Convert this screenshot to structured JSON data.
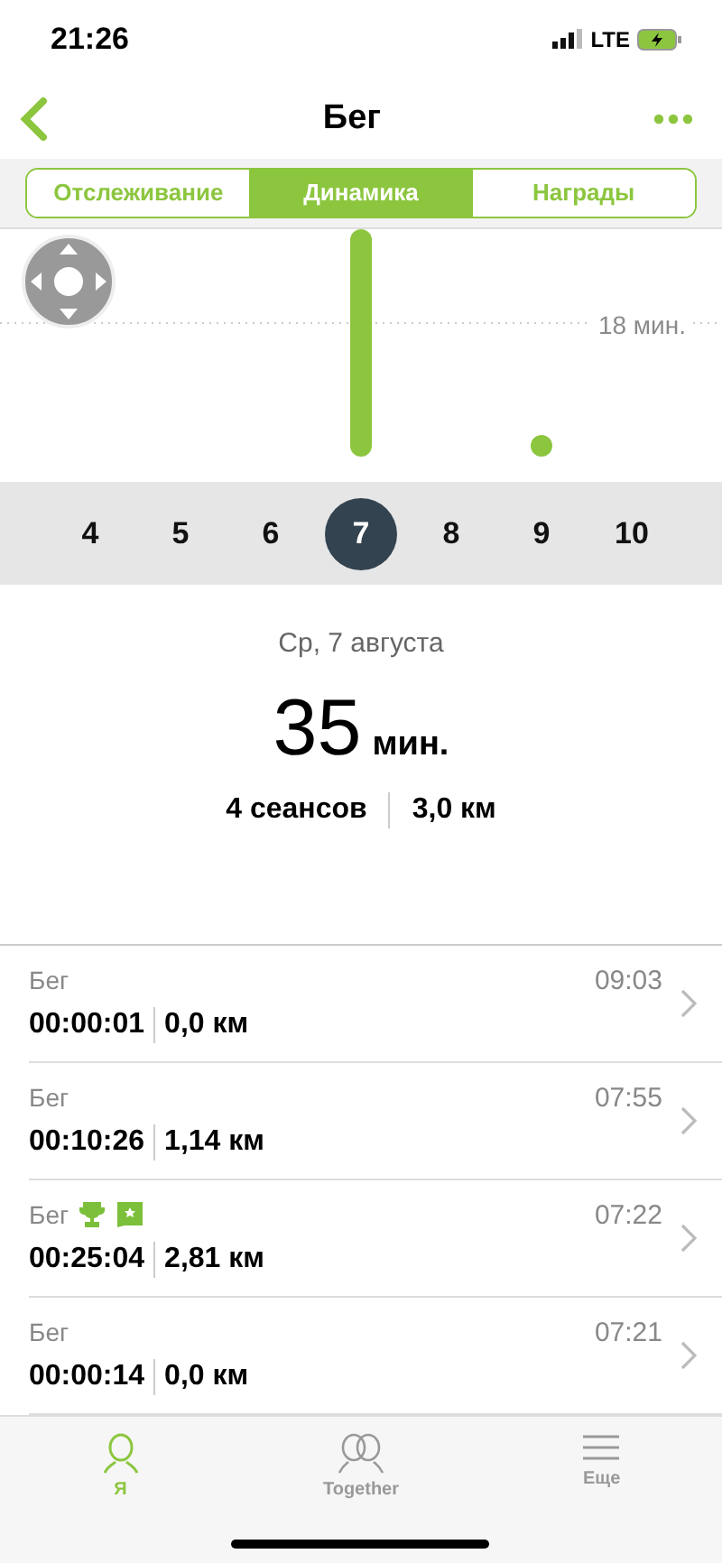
{
  "status_bar": {
    "time": "21:26",
    "network": "LTE"
  },
  "nav": {
    "title": "Бег"
  },
  "tabs": [
    {
      "label": "Отслеживание",
      "selected": false
    },
    {
      "label": "Динамика",
      "selected": true
    },
    {
      "label": "Награды",
      "selected": false
    }
  ],
  "chart": {
    "reference_label": "18 мин."
  },
  "days": [
    {
      "label": "4",
      "selected": false
    },
    {
      "label": "5",
      "selected": false
    },
    {
      "label": "6",
      "selected": false
    },
    {
      "label": "7",
      "selected": true
    },
    {
      "label": "8",
      "selected": false
    },
    {
      "label": "9",
      "selected": false
    },
    {
      "label": "10",
      "selected": false
    }
  ],
  "summary": {
    "date": "Ср, 7 августа",
    "value": "35",
    "unit": "мин.",
    "sessions": "4 сеансов",
    "distance": "3,0 км"
  },
  "workouts": [
    {
      "name": "Бег",
      "time": "09:03",
      "duration": "00:00:01",
      "distance": "0,0 км",
      "badges": false
    },
    {
      "name": "Бег",
      "time": "07:55",
      "duration": "00:10:26",
      "distance": "1,14 км",
      "badges": false
    },
    {
      "name": "Бег",
      "time": "07:22",
      "duration": "00:25:04",
      "distance": "2,81 км",
      "badges": true
    },
    {
      "name": "Бег",
      "time": "07:21",
      "duration": "00:00:14",
      "distance": "0,0 км",
      "badges": false
    }
  ],
  "bottom_tabs": [
    {
      "label": "Я",
      "kind": "me",
      "selected": true
    },
    {
      "label": "Together",
      "kind": "together",
      "selected": false
    },
    {
      "label": "Еще",
      "kind": "more",
      "selected": false
    }
  ]
}
